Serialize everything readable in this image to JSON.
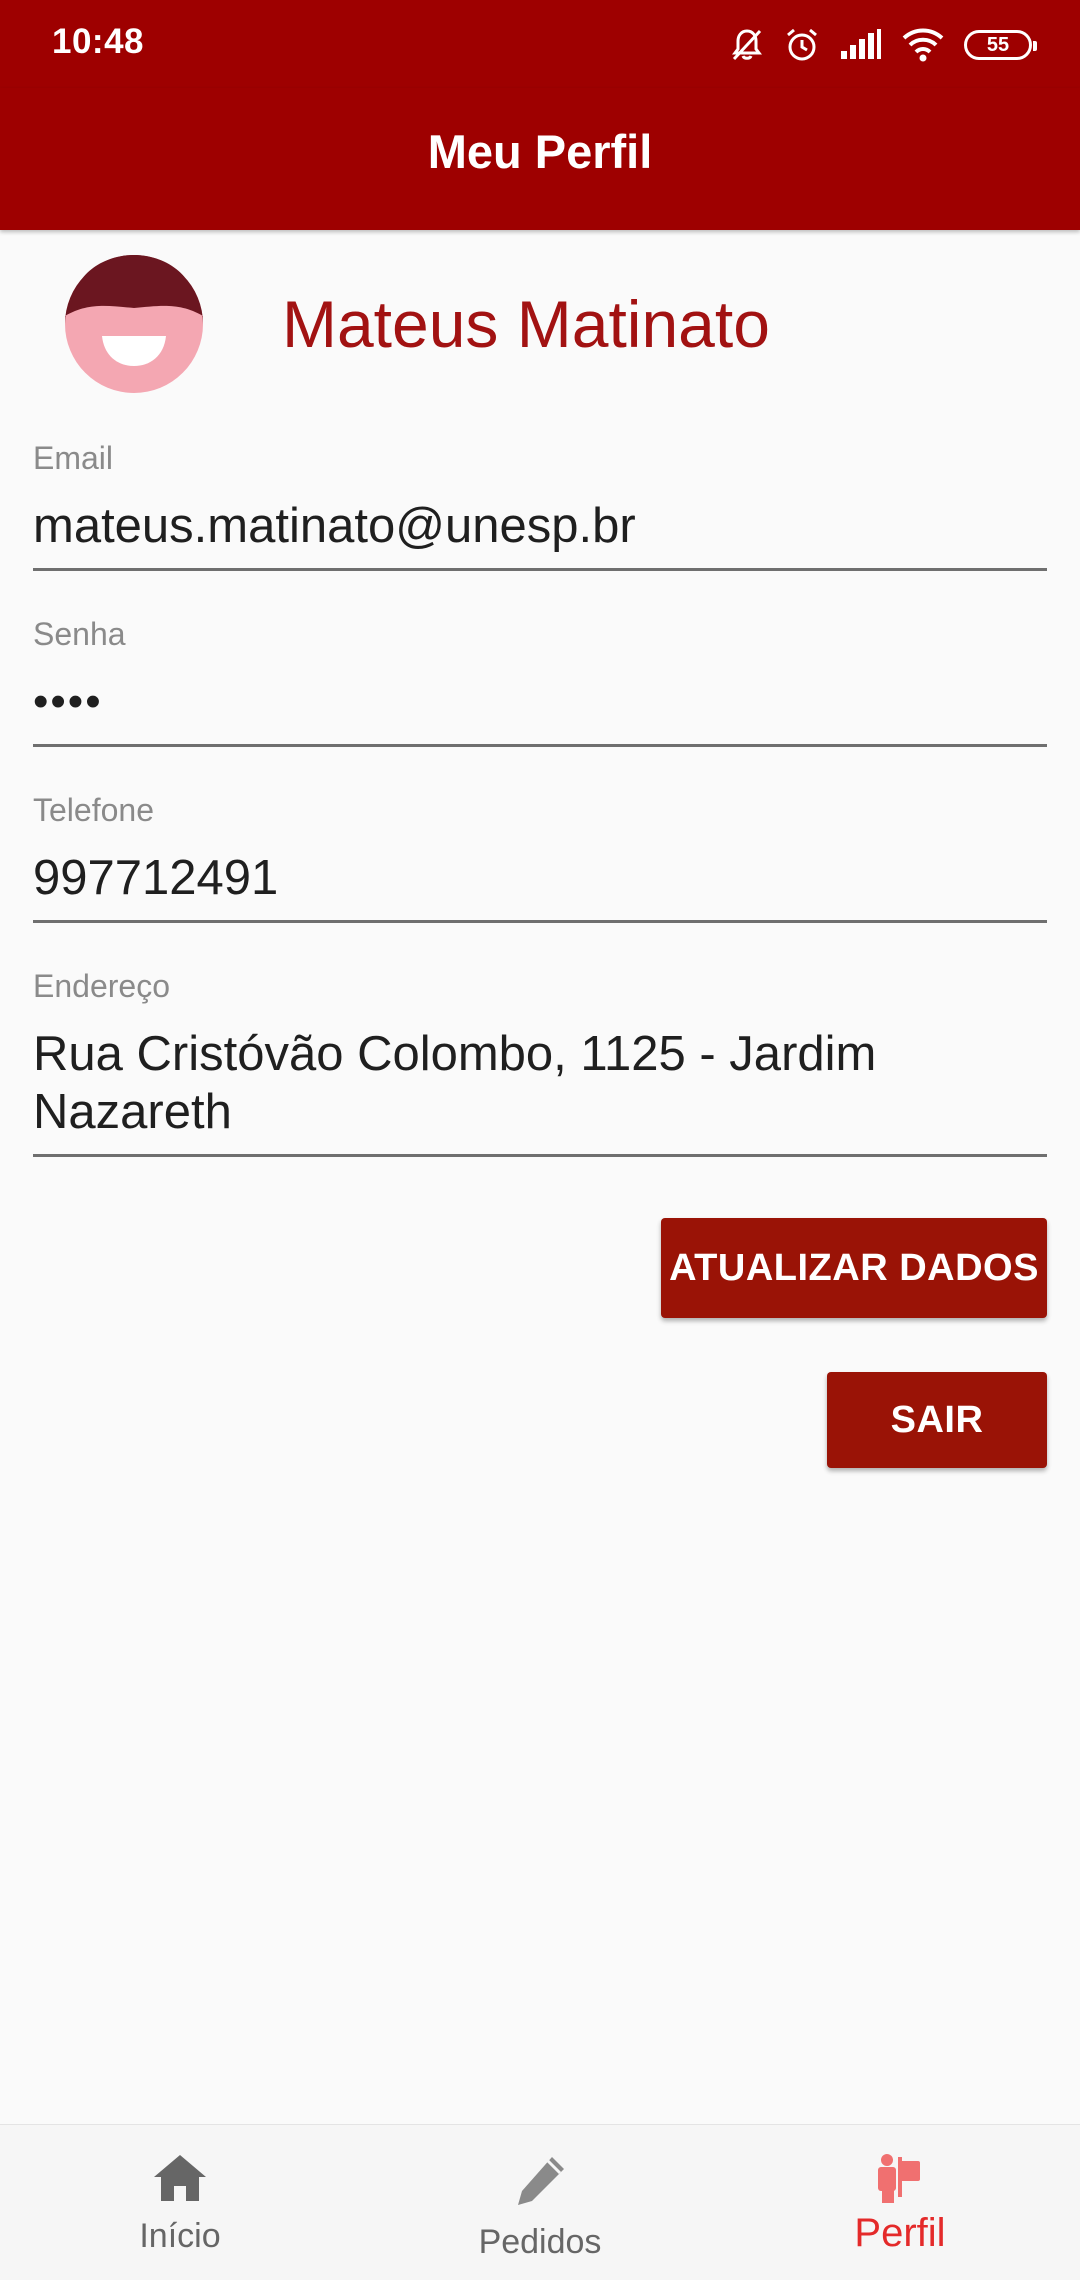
{
  "status_bar": {
    "time": "10:48",
    "battery": "55",
    "icons": [
      "bell-off-icon",
      "alarm-icon",
      "signal-icon",
      "wifi-icon",
      "battery-icon"
    ]
  },
  "app_bar": {
    "title": "Meu Perfil"
  },
  "profile": {
    "name": "Mateus Matinato"
  },
  "fields": {
    "email": {
      "label": "Email",
      "value": "mateus.matinato@unesp.br"
    },
    "password": {
      "label": "Senha",
      "value": "••••"
    },
    "phone": {
      "label": "Telefone",
      "value": "997712491"
    },
    "address": {
      "label": "Endereço",
      "value_line1": "Rua Cristóvão Colombo, 1125 - Jardim",
      "value_line2": "Nazareth"
    }
  },
  "buttons": {
    "update": "ATUALIZAR DADOS",
    "logout": "SAIR"
  },
  "bottom_nav": {
    "items": [
      {
        "label": "Início",
        "icon": "home-icon",
        "active": false
      },
      {
        "label": "Pedidos",
        "icon": "pencil-icon",
        "active": false
      },
      {
        "label": "Perfil",
        "icon": "person-icon",
        "active": true
      }
    ]
  },
  "colors": {
    "primary": "#9e0000",
    "accent_text": "#a21212",
    "button": "#9a1306",
    "nav_active": "#e42a2a"
  }
}
